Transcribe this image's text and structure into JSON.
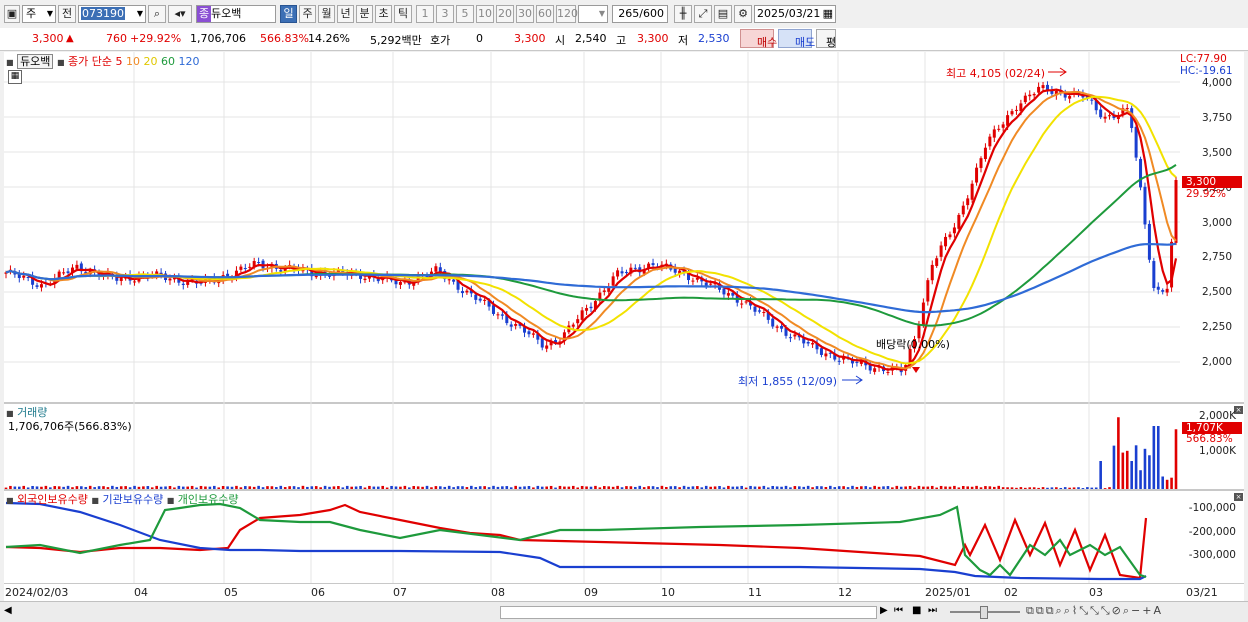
{
  "toolbar": {
    "market_label": "주",
    "prev_label": "전",
    "code_value": "073190",
    "stock_name": "듀오백",
    "stock_tag": "종",
    "period_buttons": [
      "일",
      "주",
      "월",
      "년",
      "분",
      "초",
      "틱"
    ],
    "interval_buttons": [
      "1",
      "3",
      "5",
      "10",
      "20",
      "30",
      "60",
      "120"
    ],
    "count_value": "265",
    "count_max": "/600",
    "date_value": "2025/03/21"
  },
  "quote": {
    "price": "3,300",
    "change": "760",
    "change_pct": "+29.92%",
    "volume": "1,706,706",
    "volume_pct": "566.83%",
    "turnover": "14.26%",
    "amount": "5,292백만",
    "bid_label": "호가",
    "bid_value": "0",
    "ask_price": "3,300",
    "open_label": "시",
    "open_value": "2,540",
    "high_label": "고",
    "high_value": "3,300",
    "low_label": "저",
    "low_value": "2,530",
    "buy_label": "매수",
    "sell_label": "매도",
    "eval_label": "평"
  },
  "price_panel": {
    "legend_name": "듀오백",
    "legend_type": "종가 단순",
    "ma": [
      {
        "label": "5",
        "color": "#e00000"
      },
      {
        "label": "10",
        "color": "#f08a24"
      },
      {
        "label": "20",
        "color": "#f2e200"
      },
      {
        "label": "60",
        "color": "#1e9a3c"
      },
      {
        "label": "120",
        "color": "#2f6bd6"
      }
    ],
    "lc": "LC:77.90",
    "hc": "HC:-19.61",
    "annot_high": "최고 4,105 (02/24)",
    "annot_low": "최저 1,855 (12/09)",
    "annot_div": "배당락(0.00%)",
    "y_ticks": [
      "4,000",
      "3,750",
      "3,500",
      "3,250",
      "3,000",
      "2,750",
      "2,500",
      "2,250",
      "2,000"
    ],
    "price_tag": "3,300",
    "pct_tag": "29.92%"
  },
  "volume_panel": {
    "title": "거래량",
    "value": "1,706,706주(566.83%)",
    "y_ticks": [
      "2,000K",
      "1,000K"
    ],
    "tag_value": "1,707K",
    "tag_pct": "566.83%"
  },
  "holder_panel": {
    "legend": [
      {
        "label": "외국인보유수량",
        "color": "#e00000"
      },
      {
        "label": "기관보유수량",
        "color": "#1a3fd0"
      },
      {
        "label": "개인보유수량",
        "color": "#1e9a3c"
      }
    ],
    "y_ticks": [
      "-100,000",
      "-200,000",
      "-300,000"
    ]
  },
  "x_axis": {
    "labels": [
      "2024/02/03",
      "04",
      "05",
      "06",
      "07",
      "08",
      "09",
      "10",
      "11",
      "12",
      "2025/01",
      "02",
      "03",
      "03/21"
    ]
  },
  "colors": {
    "up": "#e00000",
    "down": "#1a3fd0",
    "accent": "#3c6fb5"
  }
}
